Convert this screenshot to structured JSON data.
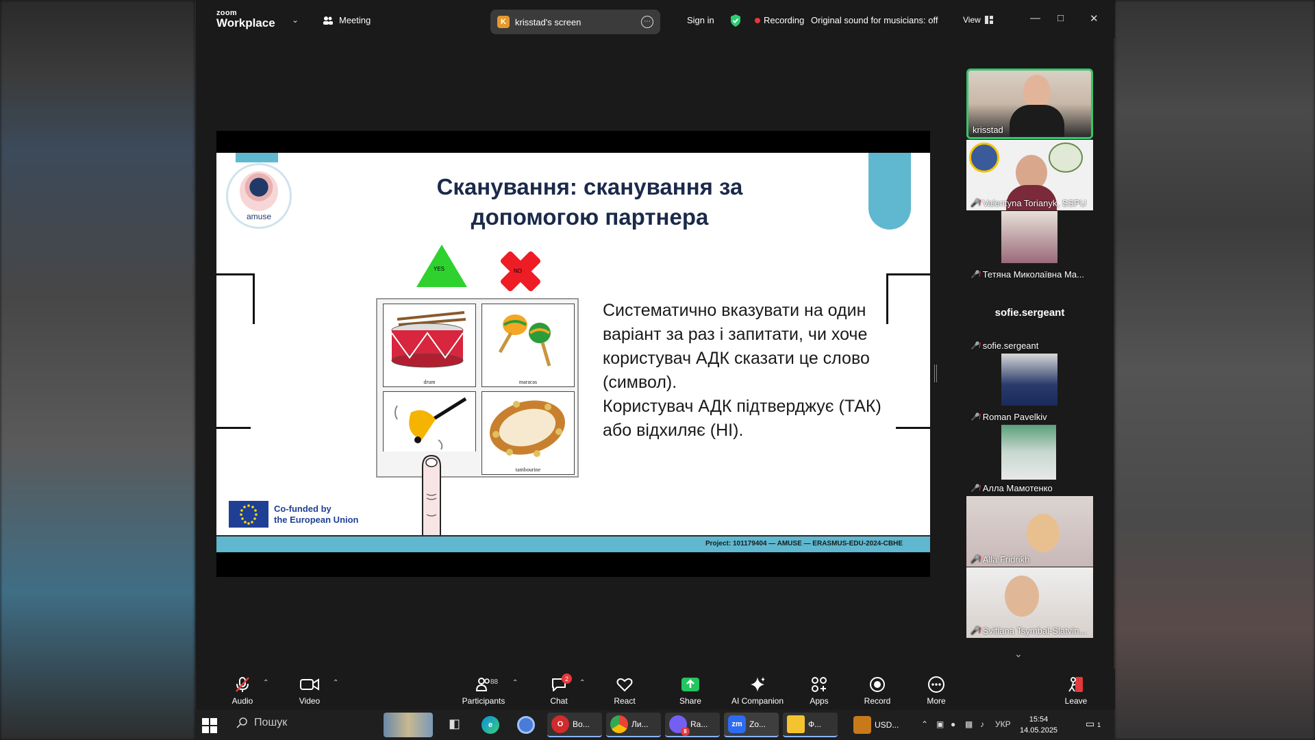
{
  "titlebar": {
    "logo_top": "zoom",
    "logo_bottom": "Workplace",
    "meeting_label": "Meeting",
    "screen_badge": "K",
    "screen_label": "krisstad's screen",
    "sign_in": "Sign in",
    "recording": "Recording",
    "original_sound": "Original sound for musicians: off",
    "view": "View"
  },
  "slide": {
    "title_line1": "Сканування: сканування за",
    "title_line2": "допомогою партнера",
    "logo_text": "amuse",
    "yes_label": "YES",
    "no_label": "NO",
    "symbols": [
      {
        "caption": "drum"
      },
      {
        "caption": "maracas"
      },
      {
        "caption": ""
      },
      {
        "caption": "tambourine"
      }
    ],
    "body_line1": "Систематично вказувати на один варіант за раз і запитати, чи хоче користувач АДК сказати це слово (символ).",
    "body_line2": "Користувач АДК підтверджує (ТАК) або відхиляє (НІ).",
    "eu_line1": "Co-funded by",
    "eu_line2": "the European Union",
    "footer": "Project: 101179404 — AMUSE — ERASMUS-EDU-2024-CBHE"
  },
  "participants": [
    {
      "name": "krisstad",
      "muted": false,
      "active": true
    },
    {
      "name": "Valentyna Torianyk, SSPU",
      "muted": true
    },
    {
      "name": "Тетяна Миколаївна Ма...",
      "muted": true
    },
    {
      "name": "sofie.sergeant",
      "muted": true,
      "display_name": "sofie.sergeant"
    },
    {
      "name": "Roman Pavelkiv",
      "muted": true
    },
    {
      "name": "Алла Мамотенко",
      "muted": true
    },
    {
      "name": "Alla Fridrikh",
      "muted": true
    },
    {
      "name": "Svitlana Tsymbal-Slatvin...",
      "muted": true
    }
  ],
  "toolbar": {
    "audio": "Audio",
    "video": "Video",
    "participants": "Participants",
    "participants_count": "88",
    "chat": "Chat",
    "chat_badge": "2",
    "react": "React",
    "share": "Share",
    "ai_companion": "AI Companion",
    "apps": "Apps",
    "record": "Record",
    "more": "More",
    "leave": "Leave"
  },
  "taskbar": {
    "search_placeholder": "Пошук",
    "apps": [
      {
        "label": "Во..."
      },
      {
        "label": "Ли..."
      },
      {
        "label": "Ra..."
      },
      {
        "label": "Zo..."
      },
      {
        "label": "Ф..."
      }
    ],
    "viber_badge": "8",
    "weather": "USD...",
    "lang": "УКР",
    "time": "15:54",
    "date": "14.05.2025",
    "notifications": "1"
  },
  "colors": {
    "accent_teal": "#5fb8cf",
    "recording_red": "#e5383b",
    "share_green": "#22c55e",
    "active_speaker": "#34c76b"
  }
}
